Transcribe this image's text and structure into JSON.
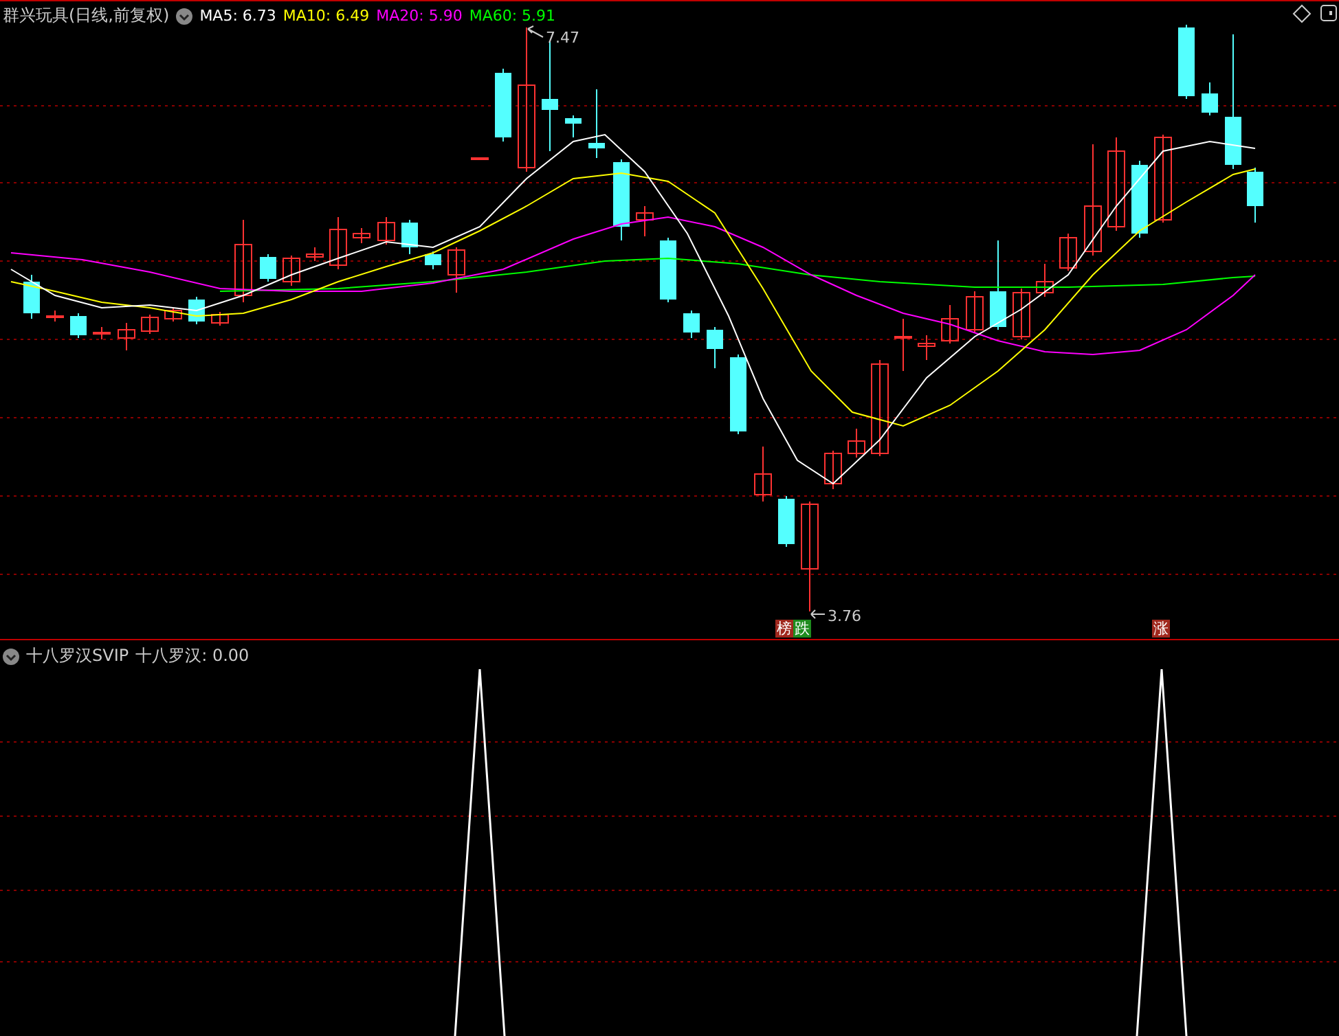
{
  "main_panel": {
    "title": "群兴玩具(日线,前复权)",
    "indicators": [
      {
        "name": "MA5:",
        "value": "6.73",
        "color": "#ffffff"
      },
      {
        "name": "MA10:",
        "value": "6.49",
        "color": "#ffff00"
      },
      {
        "name": "MA20:",
        "value": "5.90",
        "color": "#ff00ff"
      },
      {
        "name": "MA60:",
        "value": "5.91",
        "color": "#00ff00"
      }
    ],
    "high_label": "7.47",
    "low_label": "3.76",
    "signals": [
      {
        "parts": [
          {
            "text": "榜",
            "color": "#a0281e"
          },
          {
            "text": "跌",
            "color": "#1e8c1e"
          }
        ]
      },
      {
        "parts": [
          {
            "text": "涨",
            "color": "#a0281e"
          }
        ]
      }
    ]
  },
  "sub_panel": {
    "title": "十八罗汉SVIP",
    "reading": "十八罗汉: 0.00"
  }
}
